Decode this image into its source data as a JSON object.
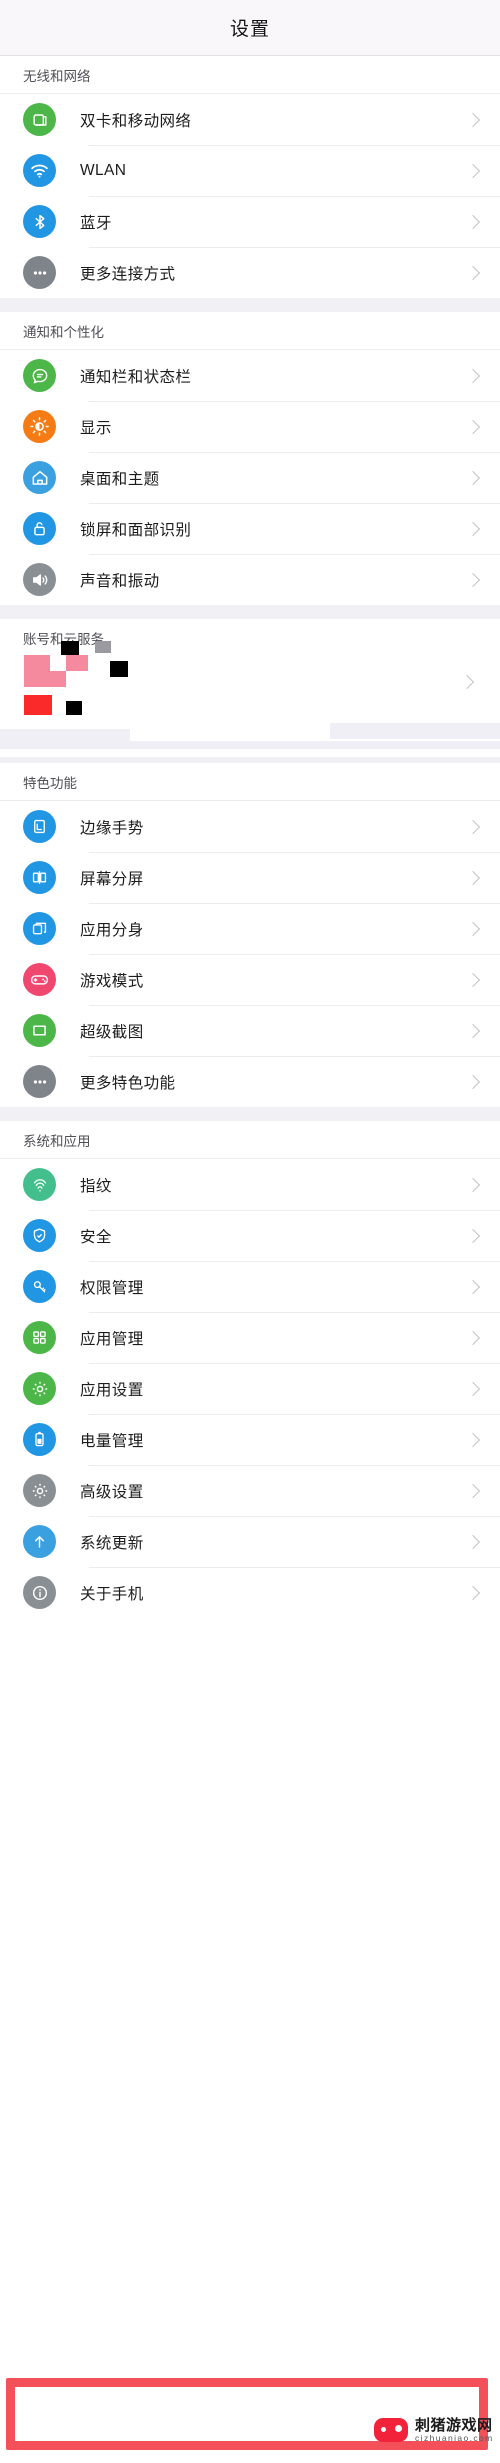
{
  "header": {
    "title": "设置"
  },
  "colors": {
    "green": "#4cb648",
    "blue": "#2196e3",
    "light_blue": "#3aa0e0",
    "gray": "#8a8f94",
    "orange": "#f57c15",
    "pink": "#f0476e",
    "teal": "#43bf8e",
    "section_bg": "#f1f1f5",
    "highlight": "#f4505a",
    "censor_red": "#fb2a2a",
    "censor_pink": "#f58a9e",
    "censor_black": "#000000",
    "censor_gray": "#9a9aa0"
  },
  "sections": [
    {
      "id": "wireless",
      "label": "无线和网络",
      "items": [
        {
          "label": "双卡和移动网络",
          "icon": "sim-card-icon",
          "icon_color": "#4cb648"
        },
        {
          "label": "WLAN",
          "icon": "wifi-icon",
          "icon_color": "#2196e3"
        },
        {
          "label": "蓝牙",
          "icon": "bluetooth-icon",
          "icon_color": "#2196e3"
        },
        {
          "label": "更多连接方式",
          "icon": "more-dots-icon",
          "icon_color": "#7e848a"
        }
      ]
    },
    {
      "id": "notification",
      "label": "通知和个性化",
      "items": [
        {
          "label": "通知栏和状态栏",
          "icon": "chat-bubble-icon",
          "icon_color": "#4cb648"
        },
        {
          "label": "显示",
          "icon": "brightness-icon",
          "icon_color": "#f57c15"
        },
        {
          "label": "桌面和主题",
          "icon": "home-icon",
          "icon_color": "#3aa0e0"
        },
        {
          "label": "锁屏和面部识别",
          "icon": "lock-icon",
          "icon_color": "#2196e3"
        },
        {
          "label": "声音和振动",
          "icon": "speaker-icon",
          "icon_color": "#8a8f94"
        }
      ]
    },
    {
      "id": "features",
      "label": "特色功能",
      "items": [
        {
          "label": "边缘手势",
          "icon": "edge-gesture-icon",
          "icon_color": "#2196e3"
        },
        {
          "label": "屏幕分屏",
          "icon": "split-screen-icon",
          "icon_color": "#2196e3"
        },
        {
          "label": "应用分身",
          "icon": "app-clone-icon",
          "icon_color": "#2196e3"
        },
        {
          "label": "游戏模式",
          "icon": "gamepad-icon",
          "icon_color": "#f0476e"
        },
        {
          "label": "超级截图",
          "icon": "screenshot-icon",
          "icon_color": "#4cb648"
        },
        {
          "label": "更多特色功能",
          "icon": "more-dots-icon",
          "icon_color": "#7e848a"
        }
      ]
    },
    {
      "id": "system",
      "label": "系统和应用",
      "items": [
        {
          "label": "指纹",
          "icon": "fingerprint-icon",
          "icon_color": "#43bf8e"
        },
        {
          "label": "安全",
          "icon": "shield-icon",
          "icon_color": "#2196e3"
        },
        {
          "label": "权限管理",
          "icon": "key-icon",
          "icon_color": "#2196e3"
        },
        {
          "label": "应用管理",
          "icon": "apps-grid-icon",
          "icon_color": "#4cb648"
        },
        {
          "label": "应用设置",
          "icon": "gear-icon",
          "icon_color": "#4cb648"
        },
        {
          "label": "电量管理",
          "icon": "battery-icon",
          "icon_color": "#2196e3"
        },
        {
          "label": "高级设置",
          "icon": "gear-icon",
          "icon_color": "#8a8f94"
        },
        {
          "label": "系统更新",
          "icon": "update-arrow-icon",
          "icon_color": "#3aa0e0"
        },
        {
          "label": "关于手机",
          "icon": "info-icon",
          "icon_color": "#8a8f94"
        }
      ]
    }
  ],
  "account_section": {
    "label": "账号和云服务",
    "redacted": true
  },
  "watermark": {
    "name": "刺猪游戏网",
    "url": "cizhuaniao.com",
    "icon": "gamepad-icon"
  }
}
